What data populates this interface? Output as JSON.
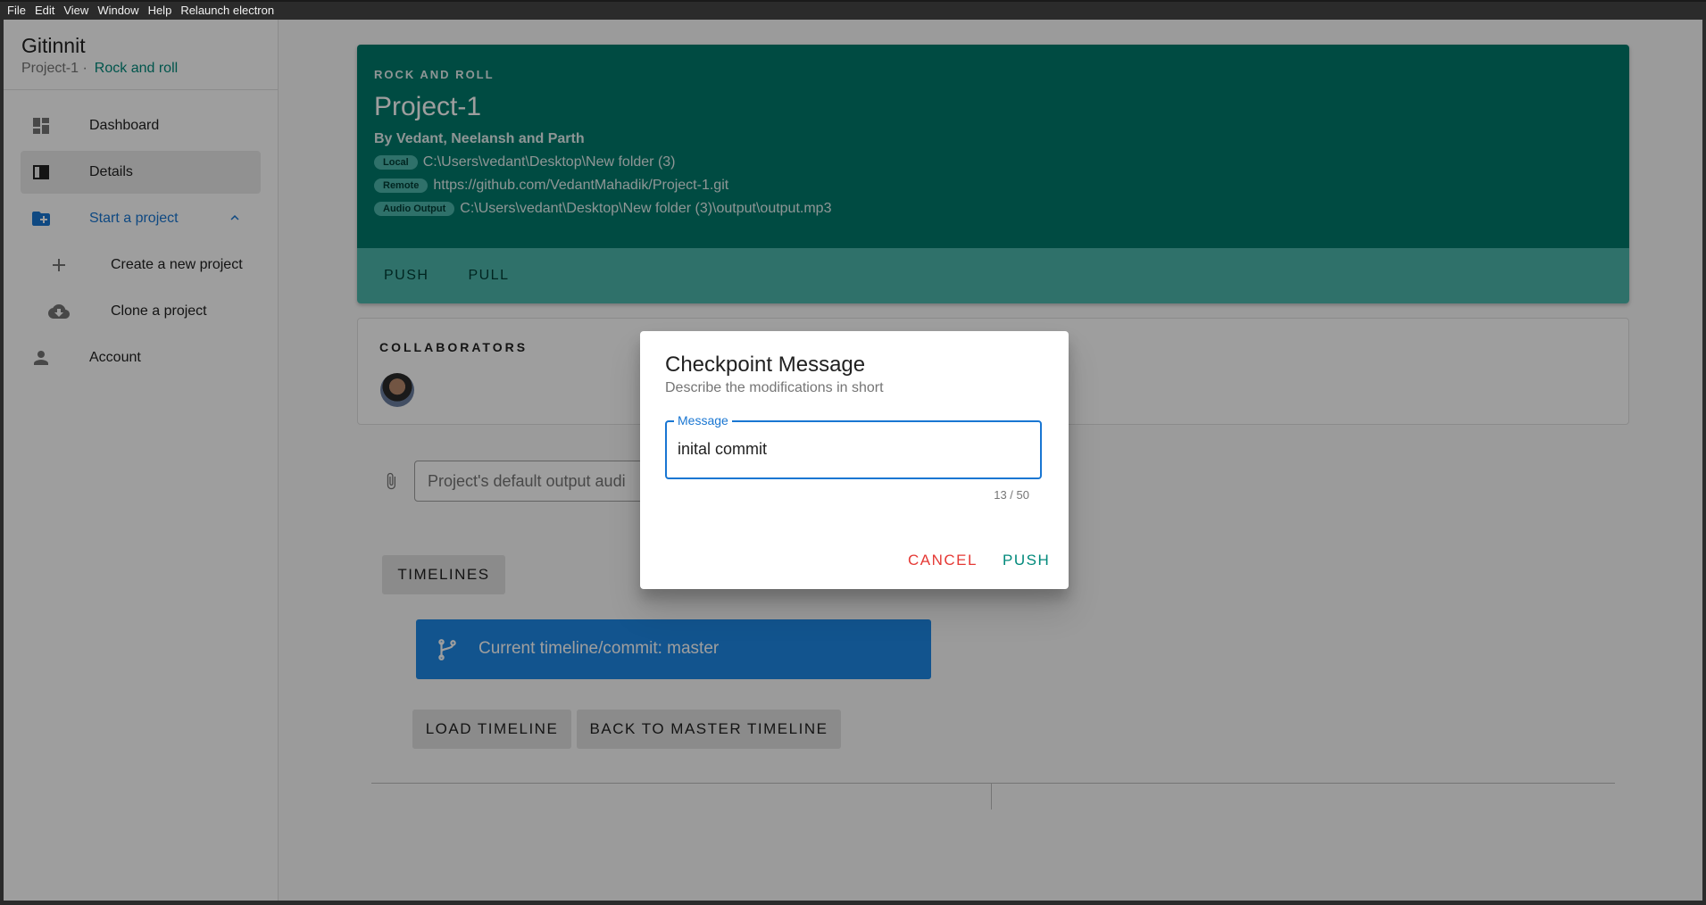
{
  "menubar": [
    "File",
    "Edit",
    "View",
    "Window",
    "Help",
    "Relaunch electron"
  ],
  "sidebar": {
    "app_title": "Gitinnit",
    "project_name": "Project-1 ·",
    "project_tagline": "Rock and roll",
    "items": [
      {
        "label": "Dashboard",
        "icon": "dashboard-icon"
      },
      {
        "label": "Details",
        "icon": "details-icon"
      },
      {
        "label": "Start a project",
        "icon": "folder-add-icon"
      },
      {
        "label": "Create a new project",
        "icon": "plus-icon"
      },
      {
        "label": "Clone a project",
        "icon": "cloud-download-icon"
      },
      {
        "label": "Account",
        "icon": "person-icon"
      }
    ]
  },
  "header": {
    "overline": "ROCK AND ROLL",
    "title": "Project-1",
    "authors": "By Vedant, Neelansh and Parth",
    "paths": [
      {
        "chip": "Local",
        "value": "C:\\Users\\vedant\\Desktop\\New folder (3)"
      },
      {
        "chip": "Remote",
        "value": "https://github.com/VedantMahadik/Project-1.git"
      },
      {
        "chip": "Audio Output",
        "value": "C:\\Users\\vedant\\Desktop\\New folder (3)\\output\\output.mp3"
      }
    ],
    "push_label": "PUSH",
    "pull_label": "PULL"
  },
  "collaborators": {
    "title": "COLLABORATORS"
  },
  "output": {
    "placeholder": "Project's default output audi"
  },
  "timelines": {
    "button_label": "TIMELINES",
    "current": "Current timeline/commit: master",
    "load_label": "LOAD TIMELINE",
    "back_label": "BACK TO MASTER TIMELINE"
  },
  "dialog": {
    "title": "Checkpoint Message",
    "subtitle": "Describe the modifications in short",
    "field_label": "Message",
    "field_value": "inital commit",
    "counter": "13 / 50",
    "cancel_label": "CANCEL",
    "push_label": "PUSH"
  },
  "colors": {
    "primary": "#00796b",
    "primary_light": "#4db6ac",
    "accent_blue": "#1976d2",
    "danger": "#e53935"
  }
}
